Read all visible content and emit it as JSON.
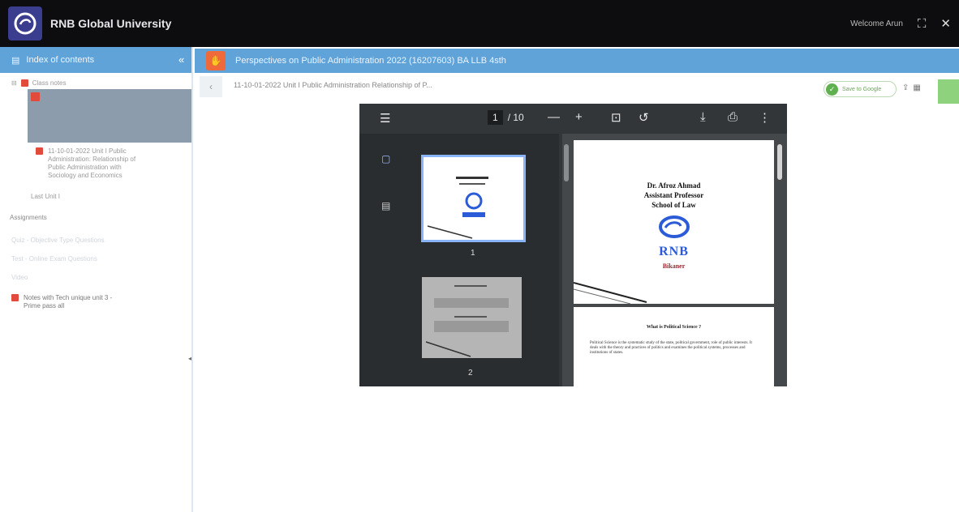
{
  "app": {
    "title": "RNB Global University",
    "welcome": "Welcome Arun"
  },
  "sidebar": {
    "header": "Index of contents",
    "items": [
      {
        "label": "Class notes"
      },
      {
        "label": "11-10-01-2022 Unit I Public Administration: Relationship of Public Administration with Sociology and Economics"
      },
      {
        "label": "Last Unit I"
      },
      {
        "label": "Assignments"
      },
      {
        "label": "Quiz - Objective Type Questions"
      },
      {
        "label": "Test - Online Exam Questions"
      },
      {
        "label": "Video"
      },
      {
        "label": "Notes with Tech unique unit 3 - Prime pass all"
      }
    ]
  },
  "content": {
    "course_title": "Perspectives on Public Administration 2022 (16207603) BA LLB 4sth",
    "breadcrumb": "11-10-01-2022 Unit I Public Administration Relationship of P...",
    "gdrive_label": "Save to Google"
  },
  "viewer": {
    "page_current": "1",
    "page_total": "/ 10",
    "thumb_labels": [
      "1",
      "2"
    ],
    "page1": {
      "name": "Dr. Afroz Ahmad",
      "title": "Assistant Professor",
      "school": "School of Law",
      "brand": "RNB",
      "city": "Bikaner"
    },
    "page2": {
      "heading": "What is Political Science ?",
      "body": "Political Science is the systematic study of the state, political government, role of public interests. It deals with the theory and practices of politics and examines the political systems, processes and institutions of states."
    }
  },
  "colors": {
    "topbar": "#0d0d0f",
    "header_blue": "#5fa3d9",
    "accent_orange": "#ee6a3a",
    "viewer_bg": "#323639"
  }
}
